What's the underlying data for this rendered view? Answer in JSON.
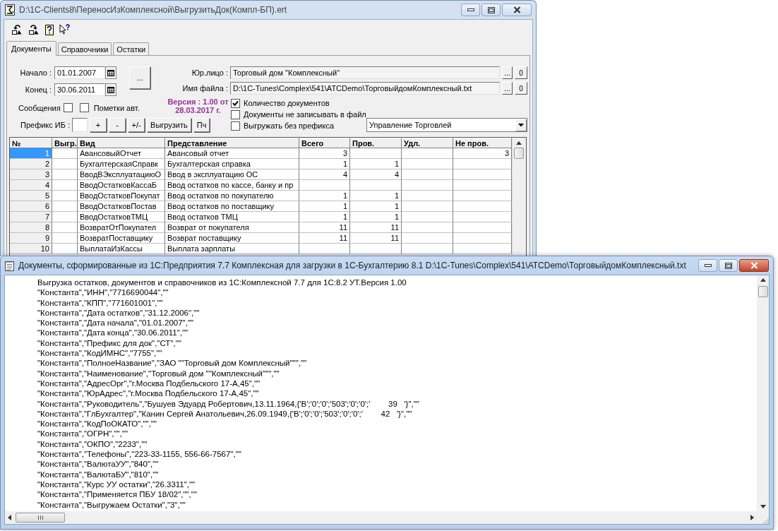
{
  "main_window": {
    "title": "D:\\1C-Clients8\\ПереносИзКомплексной\\ВыгрузитьДок(Компл-БП).ert",
    "tabs": [
      {
        "label": "Документы",
        "selected": true
      },
      {
        "label": "Справочники",
        "selected": false
      },
      {
        "label": "Остатки",
        "selected": false
      }
    ],
    "form": {
      "start": {
        "label": "Начало :",
        "value": "01.01.2007"
      },
      "end": {
        "label": "Конец :",
        "value": "30.06.2011"
      },
      "period_button": "...",
      "legal_entity": {
        "label": "Юр.лицо :",
        "value": "Торговый дом \"Комплексный\"",
        "browse": "...",
        "clear": "0"
      },
      "file": {
        "label": "Имя файла :",
        "value": "D:\\1C-Tunes\\Complex\\541\\ATCDemo\\ТорговыйдомКомплексный.txt",
        "browse": "...",
        "clear": "0"
      },
      "version": [
        "Версия : 1.00 от",
        "28.03.2017 г."
      ],
      "messages": {
        "label": "Сообщения",
        "checked": false
      },
      "auto_marks": {
        "label": "Пометки авт.",
        "checked": false
      },
      "prefix_label": "Префикс ИБ :",
      "buttons": [
        "+",
        "-",
        "+/-",
        "Выгрузить",
        "Пч"
      ],
      "options": [
        {
          "label": "Количество документов",
          "checked": true
        },
        {
          "label": "Документы не записывать в файл",
          "checked": false
        },
        {
          "label": "Выгружать без префикса",
          "checked": false
        }
      ],
      "config": "Управление Торговлей"
    },
    "table": {
      "columns": [
        "№",
        "Выгр.",
        "Вид",
        "Представление",
        "Всего",
        "Пров.",
        "Удл.",
        "Не пров."
      ],
      "rows": [
        {
          "n": "1",
          "kind": "АвансовыйОтчет",
          "view": "Авансовый отчет",
          "total": "3",
          "unposted": "3",
          "selected": true
        },
        {
          "n": "2",
          "kind": "БухгалтерскаяСправк",
          "view": "Бухгалтерская справка",
          "total": "1",
          "posted": "1",
          "selected": false
        },
        {
          "n": "3",
          "kind": "ВводВЭксплуатациюО",
          "view": "Ввод в эксплуатацию ОС",
          "total": "4",
          "posted": "4",
          "selected": false
        },
        {
          "n": "4",
          "kind": "ВводОстатковКассаБ",
          "view": "Ввод остатков по кассе, банку и пр",
          "selected": false
        },
        {
          "n": "5",
          "kind": "ВводОстатковПокупат",
          "view": "Ввод остатков по покупателю",
          "total": "1",
          "posted": "1",
          "selected": false
        },
        {
          "n": "6",
          "kind": "ВводОстатковПостав",
          "view": "Ввод остатков по поставщику",
          "total": "1",
          "posted": "1",
          "selected": false
        },
        {
          "n": "7",
          "kind": "ВводОстатковТМЦ",
          "view": "Ввод остатков ТМЦ",
          "total": "1",
          "posted": "1",
          "selected": false
        },
        {
          "n": "8",
          "kind": "ВозвратОтПокупател",
          "view": "Возврат от покупателя",
          "total": "11",
          "posted": "11",
          "selected": false
        },
        {
          "n": "9",
          "kind": "ВозвратПоставщику",
          "view": "Возврат поставщику",
          "total": "11",
          "posted": "11",
          "selected": false
        },
        {
          "n": "10",
          "kind": "ВыплатаИзКассы",
          "view": "Выплата зарплаты",
          "selected": false
        }
      ]
    }
  },
  "text_window": {
    "title": "Документы, сформированные из 1С:Предприятия 7.7 Комплексная для загрузки в 1С-Бухгалтерию 8.1 D:\\1C-Tunes\\Complex\\541\\ATCDemo\\ТорговыйдомКомплексный.txt",
    "lines": [
      "Выгрузка остатков, документов и справочников из 1С:Комплексной 7.7 для 1С:8.2 УТ.Версия 1.00",
      "\"Константа\",\"ИНН\",\"7716690044\",\"\"",
      "\"Константа\",\"КПП\",\"771601001\",\"\"",
      "\"Константа\",\"Дата остатков\",\"31.12.2006\",\"\"",
      "\"Константа\",\"Дата начала\",\"01.01.2007\",\"\"",
      "\"Константа\",\"Дата конца\",\"30.06.2011\",\"\"",
      "\"Константа\",\"Префикс для док\",\"СТ\",\"\"",
      "\"Константа\",\"КодИМНС\",\"7755\",\"\"",
      "\"Константа\",\"ПолноеНазвание\",\"ЗАО \"\"Торговый дом Комплексный\"\"\",\"\"",
      "\"Константа\",\"Наименование\",\"Торговый дом \"\"Комплексный\"\"\",\"\"",
      "\"Константа\",\"АдресОрг\",\"г.Москва Подбельского 17-А,45\",\"\"",
      "\"Константа\",\"ЮрАдрес\",\"г.Москва Подбельского 17-А,45\",\"\"",
      "\"Константа\",\"Руководитель\",\"Бушуев Эдуард Робертович,13.11.1964,{'В';'0';'0';'503';'0';'0';'        39   '}\",\"\"",
      "\"Константа\",\"ГлБухгалтер\",\"Канин Сергей Анатольевич,26.09.1949,{'В';'0';'0';'503';'0';'0';'        42   '}\",\"\"",
      "\"Константа\",\"КодПоОКАТО\",\"\",\"\"",
      "\"Константа\",\"ОГРН\",\"\",\"\"",
      "\"Константа\",\"ОКПО\",\"2233\",\"\"",
      "\"Константа\",\"Телефоны\",\"223-33-1155, 556-66-7567\",\"\"",
      "\"Константа\",\"ВалютаУУ\",\"840\",\"\"",
      "\"Константа\",\"ВалютаБУ\",\"810\",\"\"",
      "\"Константа\",\"Курс УУ остатки\",\"26.3311\",\"\"",
      "\"Константа\",\"Применяется ПБУ 18/02\",\"\",\"\"",
      "\"Константа\",\"Выгружаем Остатки\",\"3\",\"\""
    ]
  }
}
